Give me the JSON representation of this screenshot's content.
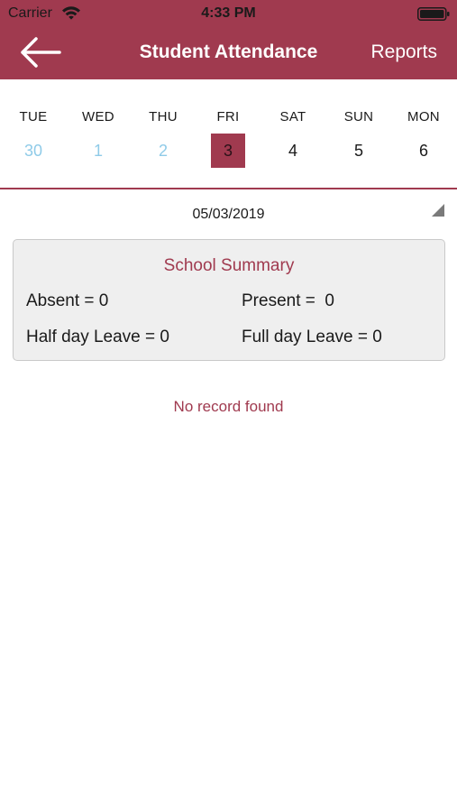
{
  "status_bar": {
    "carrier": "Carrier",
    "time": "4:33 PM"
  },
  "nav": {
    "title": "Student Attendance",
    "reports_label": "Reports",
    "back_icon": "arrow-left-icon"
  },
  "week": {
    "days": [
      {
        "name": "TUE",
        "num": "30",
        "state": "past"
      },
      {
        "name": "WED",
        "num": "1",
        "state": "past"
      },
      {
        "name": "THU",
        "num": "2",
        "state": "past"
      },
      {
        "name": "FRI",
        "num": "3",
        "state": "selected"
      },
      {
        "name": "SAT",
        "num": "4",
        "state": "future"
      },
      {
        "name": "SUN",
        "num": "5",
        "state": "future"
      },
      {
        "name": "MON",
        "num": "6",
        "state": "future"
      }
    ]
  },
  "date_row": {
    "selected_date": "05/03/2019",
    "dropdown_icon": "triangle-corner-icon"
  },
  "summary": {
    "title": "School Summary",
    "absent": "Absent = 0",
    "present": "Present =  0",
    "half_day": "Half day Leave = 0",
    "full_day": "Full day Leave = 0"
  },
  "empty_state": "No record found",
  "colors": {
    "brand": "#a03a4f",
    "past_day": "#8fcbe8",
    "card_bg": "#efefef"
  }
}
